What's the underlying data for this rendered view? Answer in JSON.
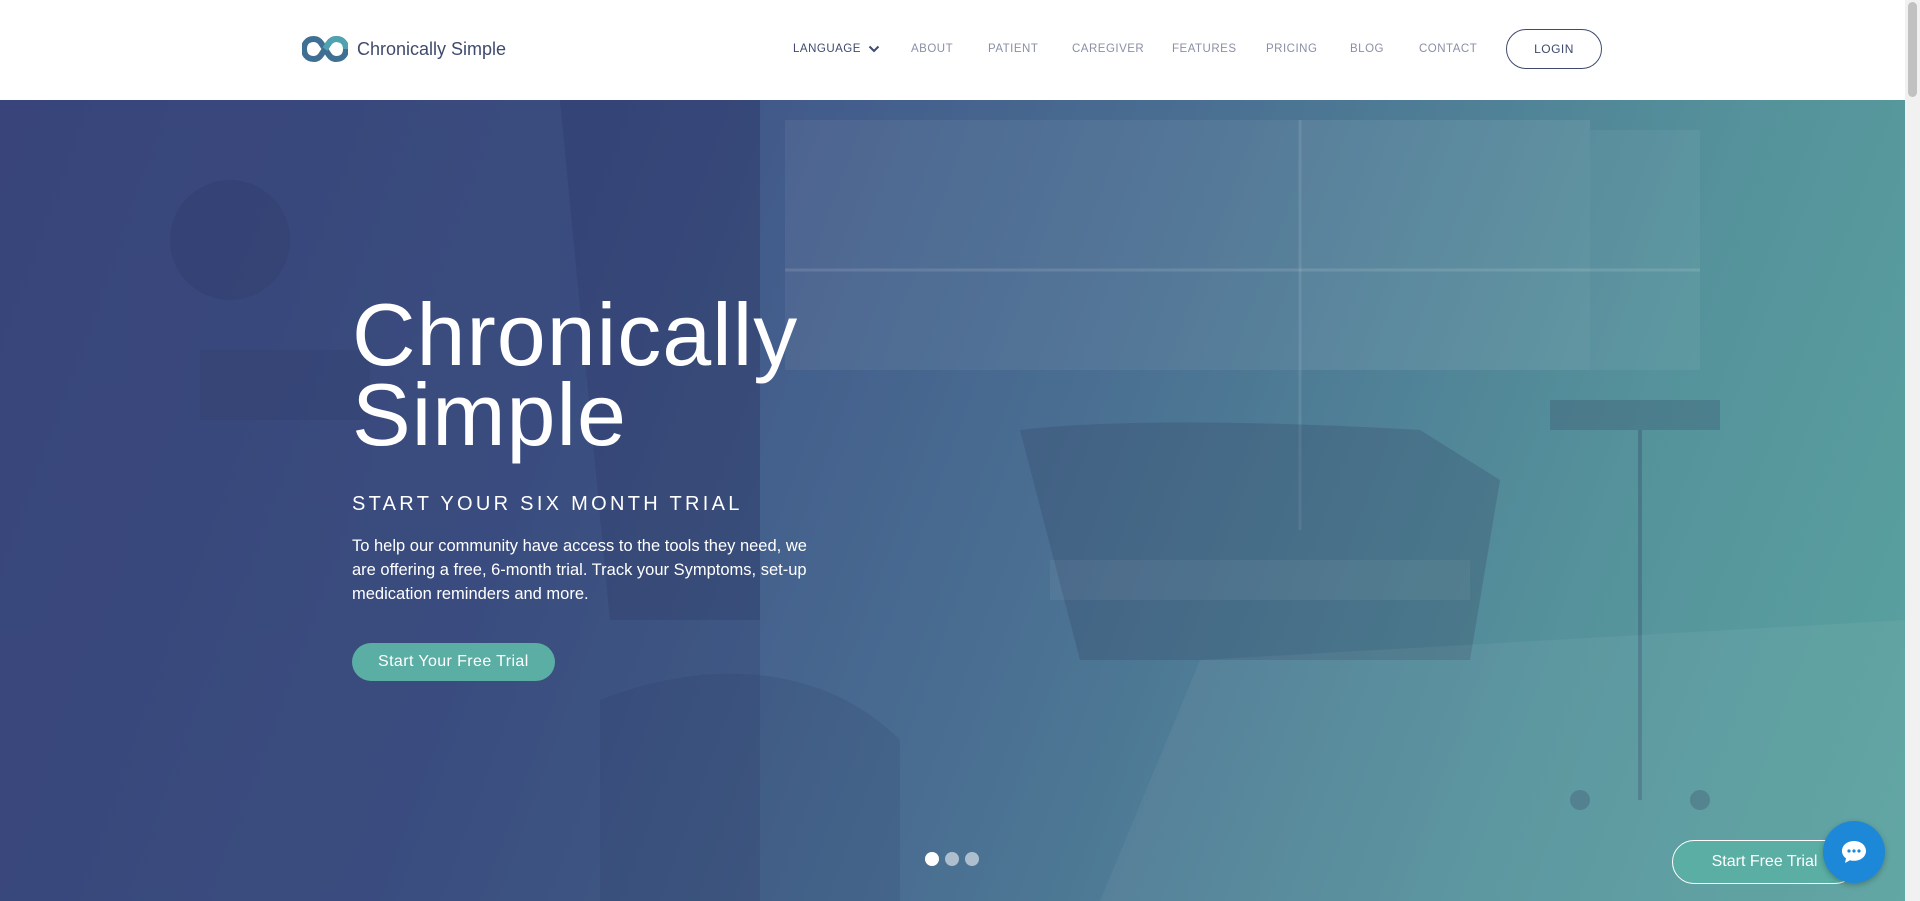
{
  "header": {
    "logo_text": "Chronically Simple",
    "nav": [
      {
        "label": "LANGUAGE",
        "has_dropdown": true
      },
      {
        "label": "ABOUT"
      },
      {
        "label": "PATIENT"
      },
      {
        "label": "CAREGIVER"
      },
      {
        "label": "FEATURES"
      },
      {
        "label": "PRICING"
      },
      {
        "label": "BLOG"
      },
      {
        "label": "CONTACT"
      }
    ],
    "login_label": "LOGIN"
  },
  "hero": {
    "title_line1": "Chronically",
    "title_line2": "Simple",
    "subtitle": "START YOUR SIX MONTH TRIAL",
    "text": "To help our community have access to the tools they need, we are offering a free, 6-month trial. Track your Symptoms, set-up medication reminders and more.",
    "cta_label": "Start Your Free Trial",
    "slides": 3,
    "active_slide": 1
  },
  "floating": {
    "trial_label": "Start Free Trial",
    "chat_icon": "chat-bubble-icon"
  },
  "colors": {
    "brand_dark": "#3f4a6e",
    "accent_teal": "#5aaea4",
    "hero_start": "#3d4a82",
    "hero_end": "#5aa3a0",
    "chat_blue": "#1e88d8"
  }
}
